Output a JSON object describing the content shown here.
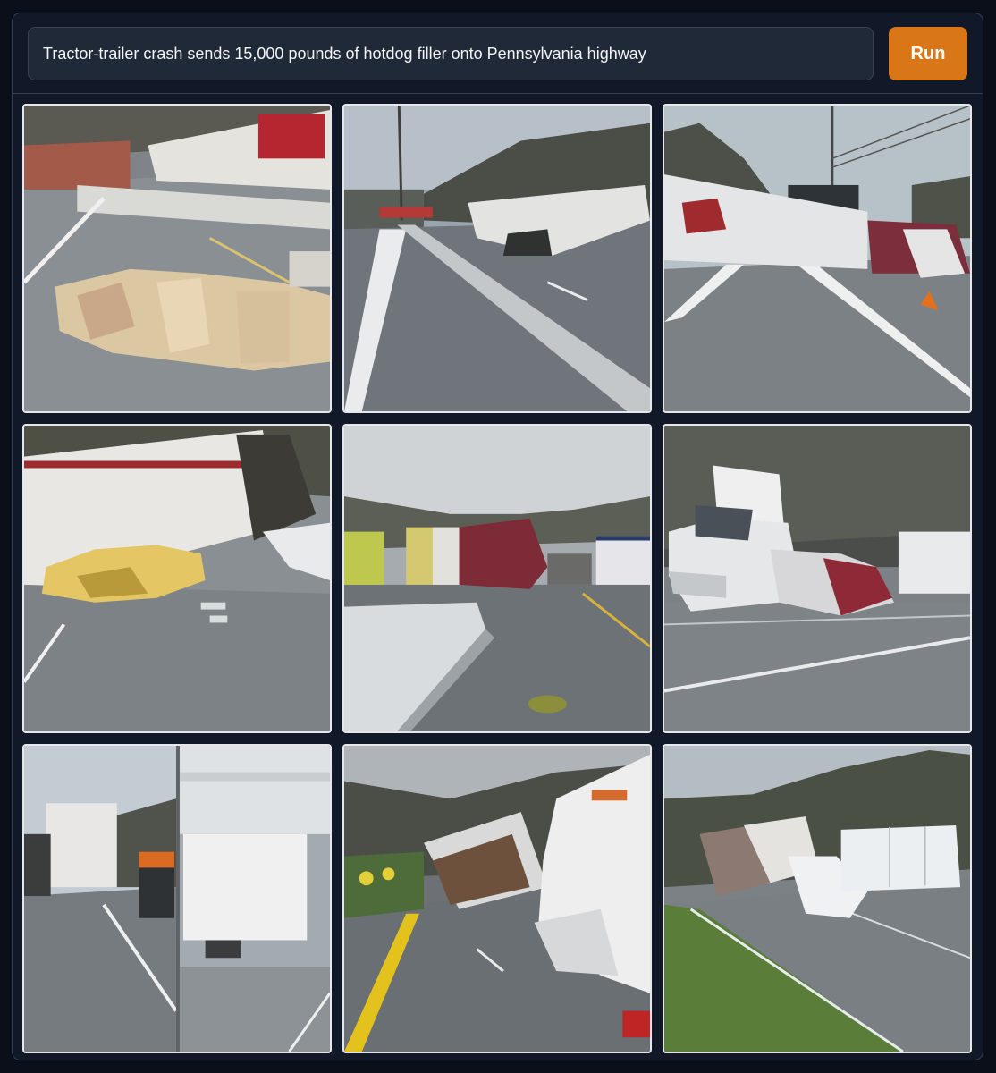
{
  "prompt": {
    "value": "Tractor-trailer crash sends 15,000 pounds of hotdog filler onto Pennsylvania highway"
  },
  "run_button": {
    "label": "Run"
  },
  "colors": {
    "accent": "#d97618",
    "panel": "#111827",
    "input": "#1f2937"
  },
  "gallery": {
    "images": [
      {
        "name": "generated-image-1"
      },
      {
        "name": "generated-image-2"
      },
      {
        "name": "generated-image-3"
      },
      {
        "name": "generated-image-4"
      },
      {
        "name": "generated-image-5"
      },
      {
        "name": "generated-image-6"
      },
      {
        "name": "generated-image-7"
      },
      {
        "name": "generated-image-8"
      },
      {
        "name": "generated-image-9"
      }
    ]
  }
}
